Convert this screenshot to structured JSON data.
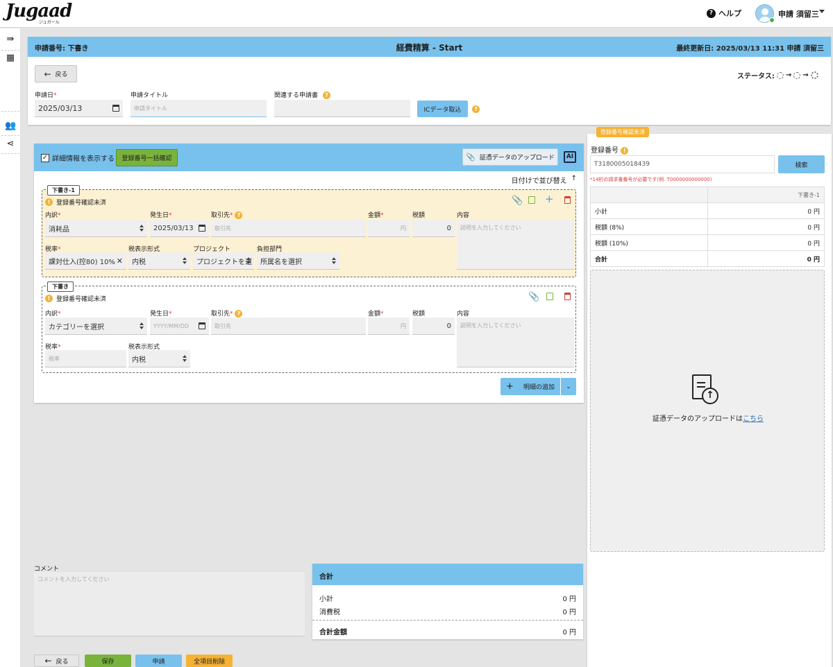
{
  "app": {
    "logo": "Jugaad",
    "logo_sub": "ジュガール",
    "help": "ヘルプ",
    "user_name": "申請 須留三"
  },
  "header": {
    "request_no_label": "申請番号:",
    "request_no_value": "下書き",
    "title": "経費精算 - Start",
    "updated": "最終更新日: 2025/03/13 11:31 申請 須留三"
  },
  "top": {
    "back": "戻る",
    "status_label": "ステータス:",
    "date_label": "申請日",
    "date_value": "2025/03/13",
    "title_label": "申請タイトル",
    "title_placeholder": "申請タイトル",
    "related_label": "関連する申請書",
    "ic_button": "ICデータ取込"
  },
  "details": {
    "show_details": "詳細情報を表示する",
    "bulk_confirm": "登録番号一括確認",
    "upload_button": "証憑データのアップロード",
    "sort": "日付けで並び替え",
    "add_item": "明細の追加"
  },
  "item1": {
    "tag": "下書き-1",
    "warning": "登録番号確認未済",
    "category_label": "内訳",
    "category_value": "消耗品",
    "date_label": "発生日",
    "date_value": "2025/03/13",
    "vendor_label": "取引先",
    "vendor_placeholder": "取引先",
    "amount_label": "金額",
    "amount_placeholder": "円",
    "tax_label": "税額",
    "tax_value": "0",
    "content_label": "内容",
    "content_placeholder": "説明を入力してください",
    "rate_label": "税率",
    "rate_value": "課対仕入(控80) 10%",
    "taxfmt_label": "税表示形式",
    "taxfmt_value": "内税",
    "project_label": "プロジェクト",
    "project_value": "プロジェクトを選",
    "dept_label": "負担部門",
    "dept_value": "所属名を選択"
  },
  "item2": {
    "tag": "下書き",
    "warning": "登録番号確認未済",
    "category_label": "内訳",
    "category_value": "カテゴリーを選択",
    "date_label": "発生日",
    "date_placeholder": "YYYY/MM/DD",
    "vendor_label": "取引先",
    "vendor_placeholder": "取引先",
    "amount_label": "金額",
    "amount_placeholder": "円",
    "tax_label": "税額",
    "tax_value": "0",
    "content_label": "内容",
    "content_placeholder": "説明を入力してください",
    "rate_label": "税率",
    "rate_placeholder": "税率",
    "taxfmt_label": "税表示形式",
    "taxfmt_value": "内税"
  },
  "comment": {
    "label": "コメント",
    "placeholder": "コメントを入力してください"
  },
  "totals": {
    "header": "合計",
    "subtotal_label": "小計",
    "subtotal_value": "0 円",
    "tax_label": "消費税",
    "tax_value": "0 円",
    "total_label": "合計金額",
    "total_value": "0 円"
  },
  "footer": {
    "back": "戻る",
    "save": "保存",
    "apply": "申請",
    "delete_all": "全項目削除"
  },
  "side": {
    "tooltip": "登録番号確認未済",
    "reg_label": "登録番号",
    "reg_value": "T3180005018439",
    "search": "検索",
    "note": "*14桁の請求書番号が必要です(例. T0000000000000)",
    "col_header": "下書き-1",
    "rows": [
      {
        "label": "小計",
        "value": "0 円"
      },
      {
        "label": "税額 (8%)",
        "value": "0 円"
      },
      {
        "label": "税額 (10%)",
        "value": "0 円"
      },
      {
        "label": "合計",
        "value": "0 円"
      }
    ],
    "upload_text": "証憑データのアップロードは",
    "upload_link": "こちら"
  }
}
